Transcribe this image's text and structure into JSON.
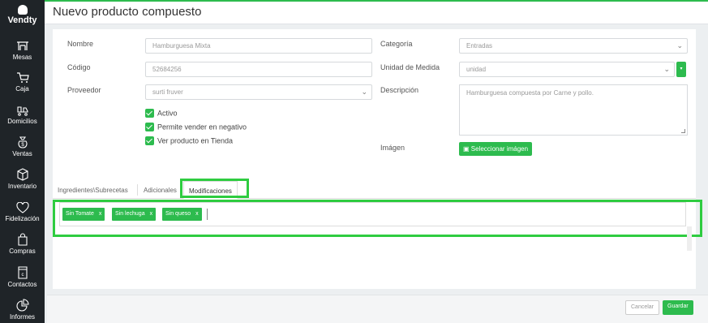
{
  "app": {
    "brand": "Vendty"
  },
  "sidebar": {
    "items": [
      {
        "label": "Mesas",
        "icon": "tables-icon"
      },
      {
        "label": "Caja",
        "icon": "cart-icon"
      },
      {
        "label": "Domicilios",
        "icon": "delivery-icon"
      },
      {
        "label": "Ventas",
        "icon": "money-bag-icon"
      },
      {
        "label": "Inventario",
        "icon": "box-icon"
      },
      {
        "label": "Fidelización",
        "icon": "heart-icon"
      },
      {
        "label": "Compras",
        "icon": "shopping-bag-icon"
      },
      {
        "label": "Contactos",
        "icon": "contacts-icon"
      },
      {
        "label": "Informes",
        "icon": "pie-chart-icon"
      }
    ]
  },
  "header": {
    "title": "Nuevo producto compuesto"
  },
  "form": {
    "nombre": {
      "label": "Nombre",
      "value": "Hamburguesa Mixta"
    },
    "codigo": {
      "label": "Código",
      "value": "52684256"
    },
    "proveedor": {
      "label": "Proveedor",
      "value": "surti fruver"
    },
    "categoria": {
      "label": "Categoría",
      "value": "Entradas"
    },
    "unidad": {
      "label": "Unidad de Medida",
      "value": "unidad"
    },
    "descripcion": {
      "label": "Descripción",
      "value": "Hamburguesa compuesta por Carne y pollo."
    },
    "imagen": {
      "label": "Imágen",
      "button": "Seleccionar imágen"
    },
    "checks": [
      "Activo",
      "Permite vender en negativo",
      "Ver producto en Tienda"
    ]
  },
  "tabs": [
    "Ingredientes\\Subrecetas",
    "Adicionales",
    "Modificaciones"
  ],
  "tags": [
    "Sin Tomate",
    "Sin lechuga",
    "Sin queso"
  ],
  "tag_remove": "x",
  "footer": {
    "cancel": "Cancelar",
    "save": "Guardar"
  },
  "colors": {
    "accent": "#2dbb4e",
    "sidebar": "#1f2428",
    "highlight": "#2ecc40"
  }
}
